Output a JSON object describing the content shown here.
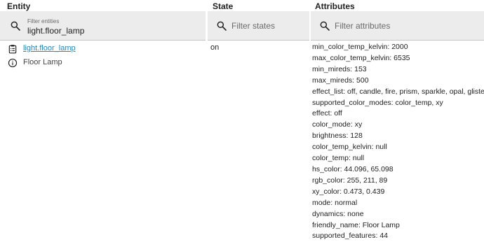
{
  "headers": {
    "entity": "Entity",
    "state": "State",
    "attributes": "Attributes"
  },
  "filters": {
    "entity": {
      "label": "Filter entities",
      "value": "light.floor_lamp"
    },
    "state": {
      "placeholder": "Filter states"
    },
    "attributes": {
      "placeholder": "Filter attributes"
    }
  },
  "row": {
    "entity_id": "light.floor_lamp",
    "friendly_name": "Floor Lamp",
    "state": "on",
    "attributes": [
      "min_color_temp_kelvin: 2000",
      "max_color_temp_kelvin: 6535",
      "min_mireds: 153",
      "max_mireds: 500",
      "effect_list: off, candle, fire, prism, sparkle, opal, glisten",
      "supported_color_modes: color_temp, xy",
      "effect: off",
      "color_mode: xy",
      "brightness: 128",
      "color_temp_kelvin: null",
      "color_temp: null",
      "hs_color: 44.096, 65.098",
      "rgb_color: 255, 211, 89",
      "xy_color: 0.473, 0.439",
      "mode: normal",
      "dynamics: none",
      "friendly_name: Floor Lamp",
      "supported_features: 44"
    ]
  },
  "icons": {
    "search": "search-icon",
    "clipboard": "clipboard-list-icon",
    "info": "info-circle-icon"
  },
  "colors": {
    "link": "#1e88c7",
    "filter_bg": "#ececec"
  }
}
